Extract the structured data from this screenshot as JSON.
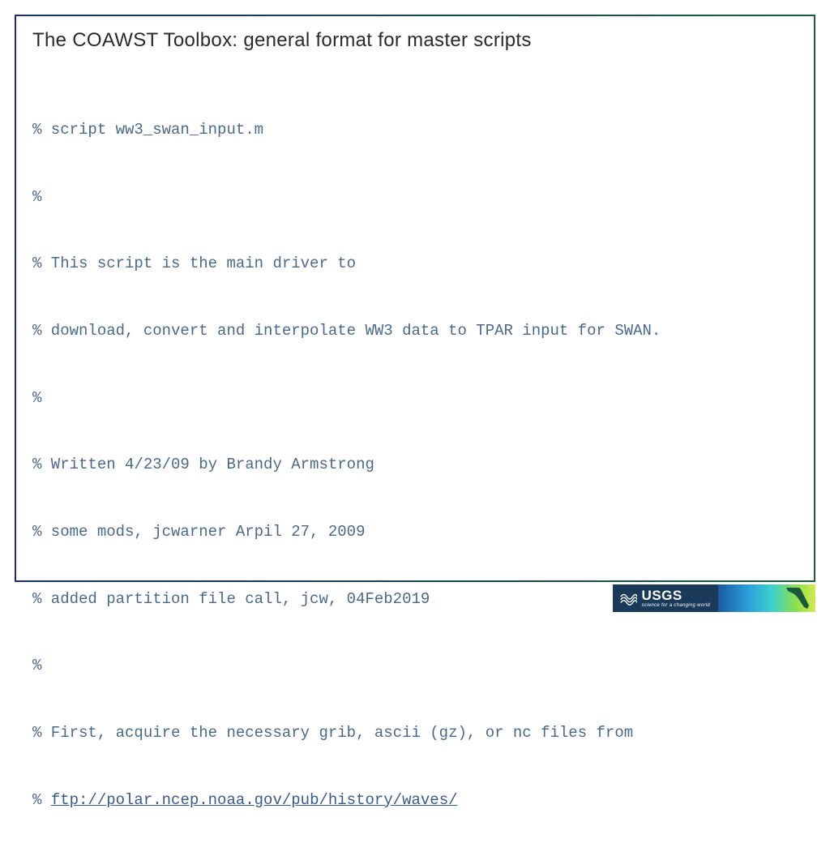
{
  "title": "The COAWST Toolbox: general format for master scripts",
  "code": {
    "lines": [
      "% script ww3_swan_input.m",
      "%",
      "% This script is the main driver to",
      "% download, convert and interpolate WW3 data to TPAR input for SWAN.",
      "%",
      "% Written 4/23/09 by Brandy Armstrong",
      "% some mods, jcwarner Arpil 27, 2009",
      "% added partition file call, jcw, 04Feb2019",
      "%",
      "% First, acquire the necessary grib, ascii (gz), or nc files from"
    ],
    "link_prefix": "% ",
    "link_text": "ftp://polar.ncep.noaa.gov/pub/history/waves/"
  },
  "footer": {
    "usgs_label": "USGS",
    "usgs_tagline": "science for a changing world"
  }
}
